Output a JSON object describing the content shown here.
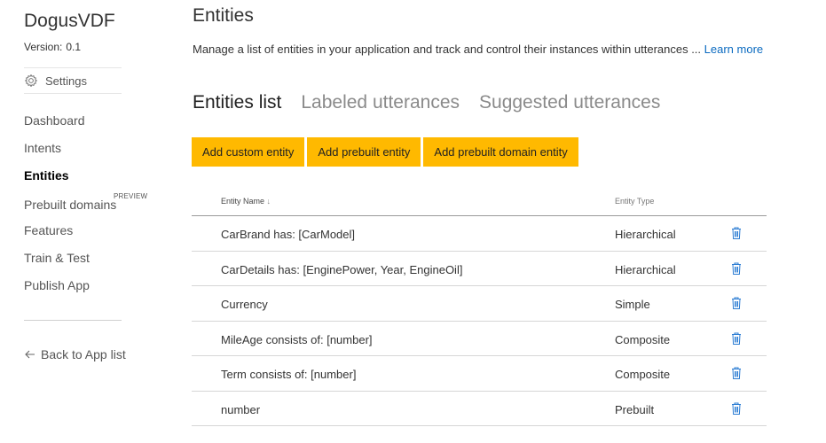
{
  "app": {
    "name": "DogusVDF",
    "version_label": "Version:",
    "version_value": "0.1"
  },
  "sidebar": {
    "settings_label": "Settings",
    "items": [
      {
        "label": "Dashboard",
        "active": false
      },
      {
        "label": "Intents",
        "active": false
      },
      {
        "label": "Entities",
        "active": true
      },
      {
        "label": "Prebuilt domains",
        "active": false,
        "badge": "PREVIEW"
      },
      {
        "label": "Features",
        "active": false
      },
      {
        "label": "Train & Test",
        "active": false
      },
      {
        "label": "Publish App",
        "active": false
      }
    ],
    "back_label": "Back to App list"
  },
  "main": {
    "title": "Entities",
    "description": "Manage a list of entities in your application and track and control their instances within utterances ... ",
    "learn_more": "Learn more",
    "tabs": [
      {
        "label": "Entities list",
        "active": true
      },
      {
        "label": "Labeled utterances",
        "active": false
      },
      {
        "label": "Suggested utterances",
        "active": false
      }
    ],
    "buttons": {
      "add_custom": "Add custom entity",
      "add_prebuilt": "Add prebuilt entity",
      "add_prebuilt_domain": "Add prebuilt domain entity"
    },
    "table": {
      "col_name": "Entity Name",
      "col_type": "Entity Type",
      "sort_indicator": "↓",
      "rows": [
        {
          "name": "CarBrand has: [CarModel]",
          "type": "Hierarchical"
        },
        {
          "name": "CarDetails has: [EnginePower, Year, EngineOil]",
          "type": "Hierarchical"
        },
        {
          "name": "Currency",
          "type": "Simple"
        },
        {
          "name": "MileAge consists of: [number]",
          "type": "Composite"
        },
        {
          "name": "Term consists of: [number]",
          "type": "Composite"
        },
        {
          "name": "number",
          "type": "Prebuilt"
        }
      ]
    }
  },
  "colors": {
    "accent_button": "#ffb900",
    "link": "#0a6ac0",
    "delete_icon": "#2b7cd3"
  },
  "icons": {
    "settings": "gear-icon",
    "back": "arrow-left-icon",
    "delete": "trash-icon"
  }
}
